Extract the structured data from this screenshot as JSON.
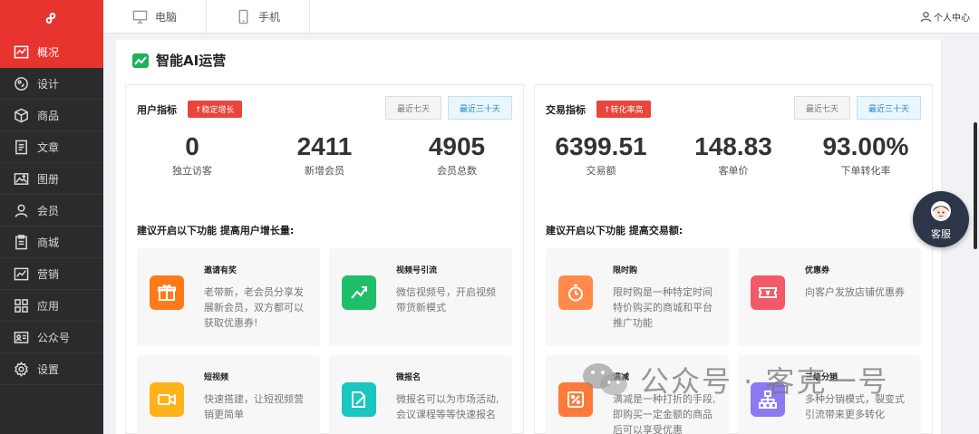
{
  "sidebar": {
    "items": [
      {
        "label": "概况",
        "icon": "chart-line-icon",
        "active": true
      },
      {
        "label": "设计",
        "icon": "palette-icon"
      },
      {
        "label": "商品",
        "icon": "cube-icon"
      },
      {
        "label": "文章",
        "icon": "document-icon"
      },
      {
        "label": "图册",
        "icon": "image-icon"
      },
      {
        "label": "会员",
        "icon": "user-icon"
      },
      {
        "label": "商城",
        "icon": "clipboard-icon"
      },
      {
        "label": "营销",
        "icon": "trend-icon"
      },
      {
        "label": "应用",
        "icon": "grid-icon"
      },
      {
        "label": "公众号",
        "icon": "id-card-icon"
      },
      {
        "label": "设置",
        "icon": "gear-icon"
      }
    ]
  },
  "topbar": {
    "tabs": [
      {
        "label": "电脑",
        "icon": "monitor-icon"
      },
      {
        "label": "手机",
        "icon": "phone-icon"
      }
    ],
    "user_center": "个人中心"
  },
  "content": {
    "title": "智能AI运营",
    "user_panel": {
      "title": "用户指标",
      "badge": "↑稳定增长",
      "ranges": [
        "最近七天",
        "最近三十天"
      ],
      "stats": [
        {
          "value": "0",
          "label": "独立访客"
        },
        {
          "value": "2411",
          "label": "新增会员"
        },
        {
          "value": "4905",
          "label": "会员总数"
        }
      ],
      "suggest": "建议开启以下功能 提高用户增长量:",
      "features": [
        {
          "name": "邀请有奖",
          "desc": "老带新，老会员分享发展新会员，双方都可以获取优惠券!",
          "color": "#ff7a1a",
          "icon": "gift-icon"
        },
        {
          "name": "视频号引流",
          "desc": "微信视频号，开启视频带货新模式",
          "color": "#1fbf6a",
          "icon": "trend-up-icon"
        },
        {
          "name": "短视频",
          "desc": "快速搭建，让短视频营销更简单",
          "color": "#ffb21a",
          "icon": "video-icon"
        },
        {
          "name": "微报名",
          "desc": "微报名可以为市场活动,会议课程等等快速报名",
          "color": "#19c6c0",
          "icon": "edit-icon"
        }
      ]
    },
    "trade_panel": {
      "title": "交易指标",
      "badge": "↑转化率高",
      "ranges": [
        "最近七天",
        "最近三十天"
      ],
      "stats": [
        {
          "value": "6399.51",
          "label": "交易额"
        },
        {
          "value": "148.83",
          "label": "客单价"
        },
        {
          "value": "93.00%",
          "label": "下单转化率"
        }
      ],
      "suggest": "建议开启以下功能 提高交易额:",
      "features": [
        {
          "name": "限时购",
          "desc": "限时购是一种特定时间特价购买的商城和平台推广功能",
          "color": "#ff8a4c",
          "icon": "stopwatch-icon"
        },
        {
          "name": "优惠券",
          "desc": "向客户发放店铺优惠券",
          "color": "#f25a6a",
          "icon": "coupon-icon"
        },
        {
          "name": "满减",
          "desc": "满减是一种打折的手段,即购买一定金额的商品后可以享受优惠",
          "color": "#ff7a3a",
          "icon": "percent-icon"
        },
        {
          "name": "三级分销",
          "desc": "多种分销模式，裂变式引流带来更多转化",
          "color": "#8a7cf0",
          "icon": "hierarchy-icon"
        }
      ]
    }
  },
  "kefu": {
    "label": "客服"
  },
  "watermark": {
    "text": "公众号 · 客克一号"
  }
}
